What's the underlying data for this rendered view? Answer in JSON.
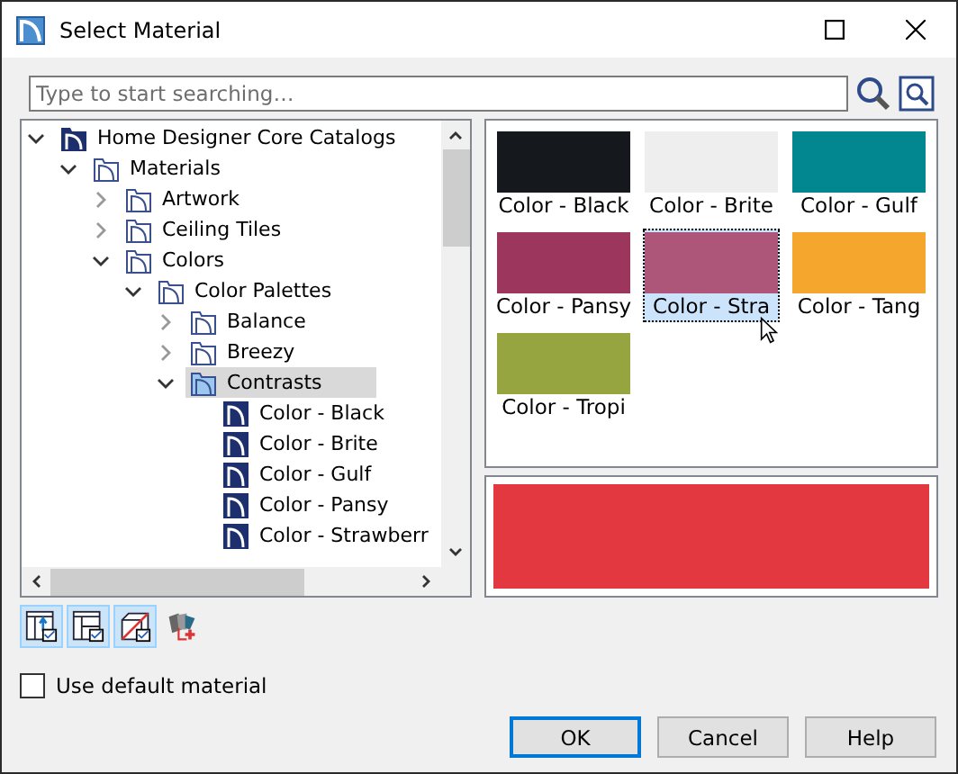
{
  "window": {
    "title": "Select Material"
  },
  "search": {
    "placeholder": "Type to start searching…"
  },
  "tree": [
    {
      "label": "Home Designer Core Catalogs",
      "kind": "catalog",
      "expanded": true,
      "selected": false,
      "children": [
        {
          "label": "Materials",
          "kind": "folder",
          "expanded": true,
          "selected": false,
          "children": [
            {
              "label": "Artwork",
              "kind": "folder",
              "expanded": false,
              "selected": false
            },
            {
              "label": "Ceiling Tiles",
              "kind": "folder",
              "expanded": false,
              "selected": false
            },
            {
              "label": "Colors",
              "kind": "folder",
              "expanded": true,
              "selected": false,
              "children": [
                {
                  "label": "Color Palettes",
                  "kind": "folder",
                  "expanded": true,
                  "selected": false,
                  "children": [
                    {
                      "label": "Balance",
                      "kind": "folder",
                      "expanded": false,
                      "selected": false
                    },
                    {
                      "label": "Breezy",
                      "kind": "folder",
                      "expanded": false,
                      "selected": false
                    },
                    {
                      "label": "Contrasts",
                      "kind": "folder",
                      "expanded": true,
                      "selected": true,
                      "children": [
                        {
                          "label": "Color - Black",
                          "kind": "material",
                          "selected": false
                        },
                        {
                          "label": "Color - Brite",
                          "kind": "material",
                          "selected": false
                        },
                        {
                          "label": "Color - Gulf",
                          "kind": "material",
                          "selected": false
                        },
                        {
                          "label": "Color - Pansy",
                          "kind": "material",
                          "selected": false
                        },
                        {
                          "label": "Color - Strawberr",
                          "kind": "material",
                          "selected": false
                        }
                      ]
                    }
                  ]
                }
              ]
            }
          ]
        }
      ]
    }
  ],
  "swatches": [
    {
      "label": "Color - Black",
      "color": "#15181c",
      "selected": false
    },
    {
      "label": "Color - Brite",
      "color": "#eeeeee",
      "selected": false
    },
    {
      "label": "Color - Gulf",
      "color": "#028690",
      "selected": false
    },
    {
      "label": "Color - Pansy",
      "color": "#9c365c",
      "selected": false
    },
    {
      "label": "Color - Stra",
      "color": "#ad5679",
      "selected": true
    },
    {
      "label": "Color - Tang",
      "color": "#f5a62c",
      "selected": false
    },
    {
      "label": "Color - Tropi",
      "color": "#96a540",
      "selected": false
    }
  ],
  "preview": {
    "color": "#e43841"
  },
  "tools": [
    {
      "kind": "up",
      "on": true
    },
    {
      "kind": "table",
      "on": true
    },
    {
      "kind": "box",
      "on": true
    },
    {
      "kind": "add",
      "on": false
    }
  ],
  "default_material": {
    "label": "Use default material",
    "checked": false
  },
  "buttons": [
    {
      "label": "OK",
      "default": true
    },
    {
      "label": "Cancel",
      "default": false
    },
    {
      "label": "Help",
      "default": false
    }
  ]
}
